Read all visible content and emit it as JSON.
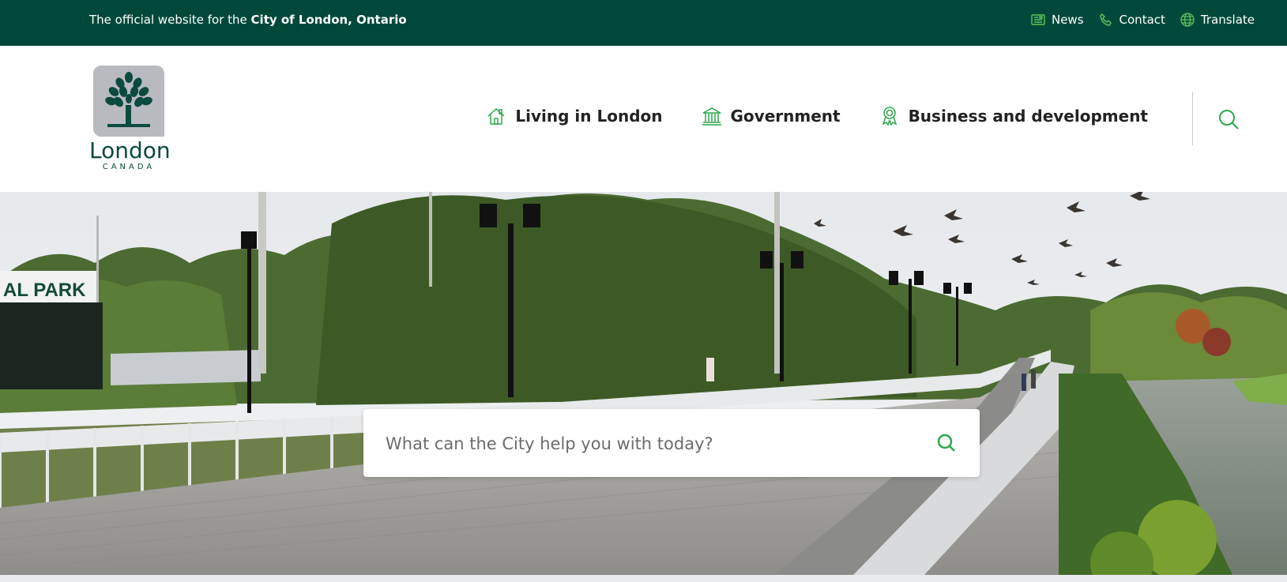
{
  "topbar": {
    "official_prefix": "The official website for the ",
    "official_bold": "City of London, Ontario",
    "links": [
      {
        "label": "News",
        "icon": "newspaper-icon"
      },
      {
        "label": "Contact",
        "icon": "phone-icon"
      },
      {
        "label": "Translate",
        "icon": "globe-icon"
      }
    ]
  },
  "logo": {
    "wordmark": "London",
    "sub": "CANADA"
  },
  "nav": [
    {
      "label": "Living in London",
      "icon": "house-icon"
    },
    {
      "label": "Government",
      "icon": "city-hall-icon"
    },
    {
      "label": "Business and development",
      "icon": "award-icon"
    }
  ],
  "search": {
    "placeholder": "What can the City help you with today?"
  },
  "hero": {
    "sign_text": "AL PARK"
  },
  "colors": {
    "brand_green": "#00493a",
    "accent_green": "#2aa84a"
  }
}
